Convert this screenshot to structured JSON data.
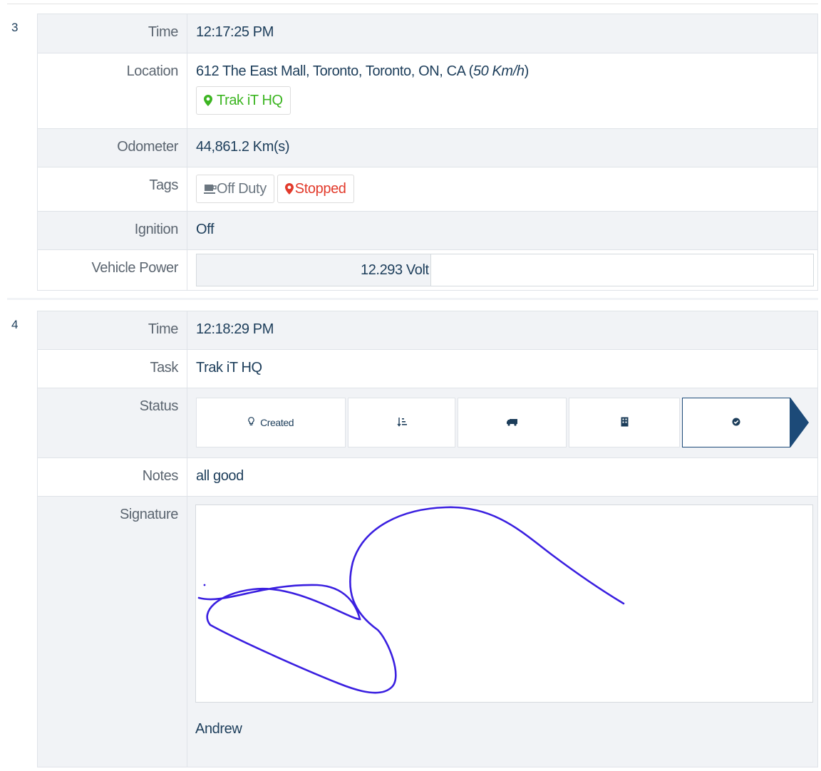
{
  "entries": [
    {
      "number": "3",
      "rows": {
        "time": {
          "label": "Time",
          "value": "12:17:25 PM"
        },
        "location": {
          "label": "Location",
          "address": "612 The East Mall, Toronto, Toronto, ON, CA (",
          "speed": "50 Km/h",
          "close_paren": ")",
          "place_chip": "Trak iT HQ"
        },
        "odometer": {
          "label": "Odometer",
          "value": "44,861.2 Km(s)"
        },
        "tags": {
          "label": "Tags",
          "items": [
            "Off Duty",
            "Stopped"
          ]
        },
        "ignition": {
          "label": "Ignition",
          "value": "Off"
        },
        "vehicle_power": {
          "label": "Vehicle Power",
          "value": "12.293 Volt",
          "fill_fraction": 0.38
        }
      }
    },
    {
      "number": "4",
      "rows": {
        "time": {
          "label": "Time",
          "value": "12:18:29 PM"
        },
        "task": {
          "label": "Task",
          "value": "Trak iT HQ"
        },
        "status": {
          "label": "Status",
          "steps": [
            {
              "icon": "lightbulb-icon",
              "text": "Created"
            },
            {
              "icon": "sort-icon",
              "text": ""
            },
            {
              "icon": "truck-icon",
              "text": ""
            },
            {
              "icon": "building-icon",
              "text": ""
            },
            {
              "icon": "check-circle-icon",
              "text": "",
              "active": true
            }
          ]
        },
        "notes": {
          "label": "Notes",
          "value": "all good"
        },
        "signature": {
          "label": "Signature",
          "name": "Andrew",
          "stroke_color": "#3a1fe0"
        }
      }
    }
  ],
  "colors": {
    "accent": "#1c4a78",
    "green": "#3cb521",
    "red": "#e23a2b",
    "text": "#1c3d5a"
  }
}
